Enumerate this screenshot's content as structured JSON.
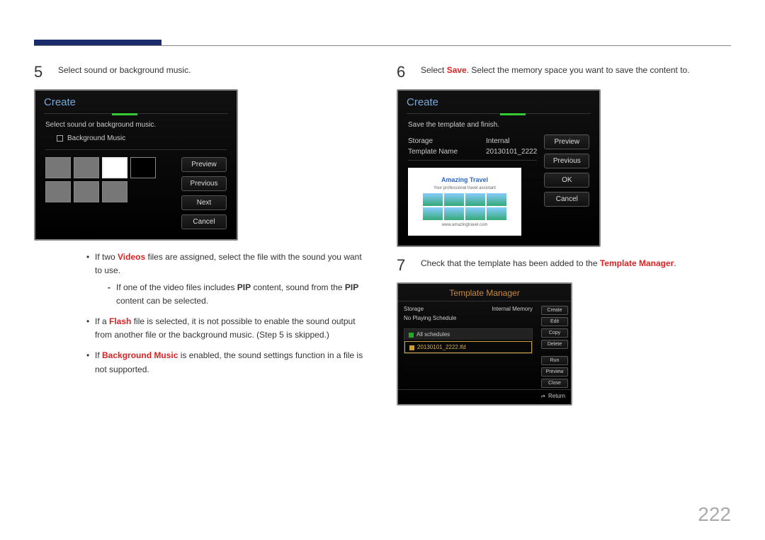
{
  "page_number": "222",
  "left": {
    "step5": {
      "num": "5",
      "text": "Select sound or background music."
    },
    "shot": {
      "title": "Create",
      "prompt": "Select sound or background music.",
      "bgmusic_label": "Background Music",
      "buttons": {
        "preview": "Preview",
        "previous": "Previous",
        "next": "Next",
        "cancel": "Cancel"
      }
    },
    "bullets": {
      "b1_pre": "If two ",
      "b1_videos": "Videos",
      "b1_post": " files are assigned, select the file with the sound you want to use.",
      "b1s_pre": "If one of the video files includes ",
      "b1s_pip1": "PIP",
      "b1s_mid": " content, sound from the ",
      "b1s_pip2": "PIP",
      "b1s_post": " content can be selected.",
      "b2_pre": "If a ",
      "b2_flash": "Flash",
      "b2_post": " file is selected, it is not possible to enable the sound output from another file or the background music. (Step 5 is skipped.)",
      "b3_pre": "If ",
      "b3_bg": "Background Music",
      "b3_post": " is enabled, the sound settings function in a file is not supported."
    }
  },
  "right": {
    "step6": {
      "num": "6",
      "pre": "Select ",
      "save": "Save",
      "post": ". Select the memory space you want to save the content to."
    },
    "shot": {
      "title": "Create",
      "prompt": "Save the template and finish.",
      "storage_k": "Storage",
      "storage_v": "Internal",
      "tname_k": "Template Name",
      "tname_v": "20130101_2222",
      "buttons": {
        "preview": "Preview",
        "previous": "Previous",
        "ok": "OK",
        "cancel": "Cancel"
      },
      "preview": {
        "title": "Amazing Travel",
        "sub": "Your professional travel assistant",
        "url": "www.amazingtravel.com"
      }
    },
    "step7": {
      "num": "7",
      "pre": "Check that the template has been added to the ",
      "tm": "Template Manager",
      "post": "."
    },
    "tmshot": {
      "title": "Template Manager",
      "storage_k": "Storage",
      "storage_v": "Internal Memory",
      "nosched": "No Playing Schedule",
      "allsched": "All schedules",
      "item": "20130101_2222.lfd",
      "buttons": {
        "create": "Create",
        "edit": "Edit",
        "copy": "Copy",
        "delete": "Delete",
        "run": "Run",
        "preview": "Preview",
        "close": "Close"
      },
      "return": "Return"
    }
  }
}
